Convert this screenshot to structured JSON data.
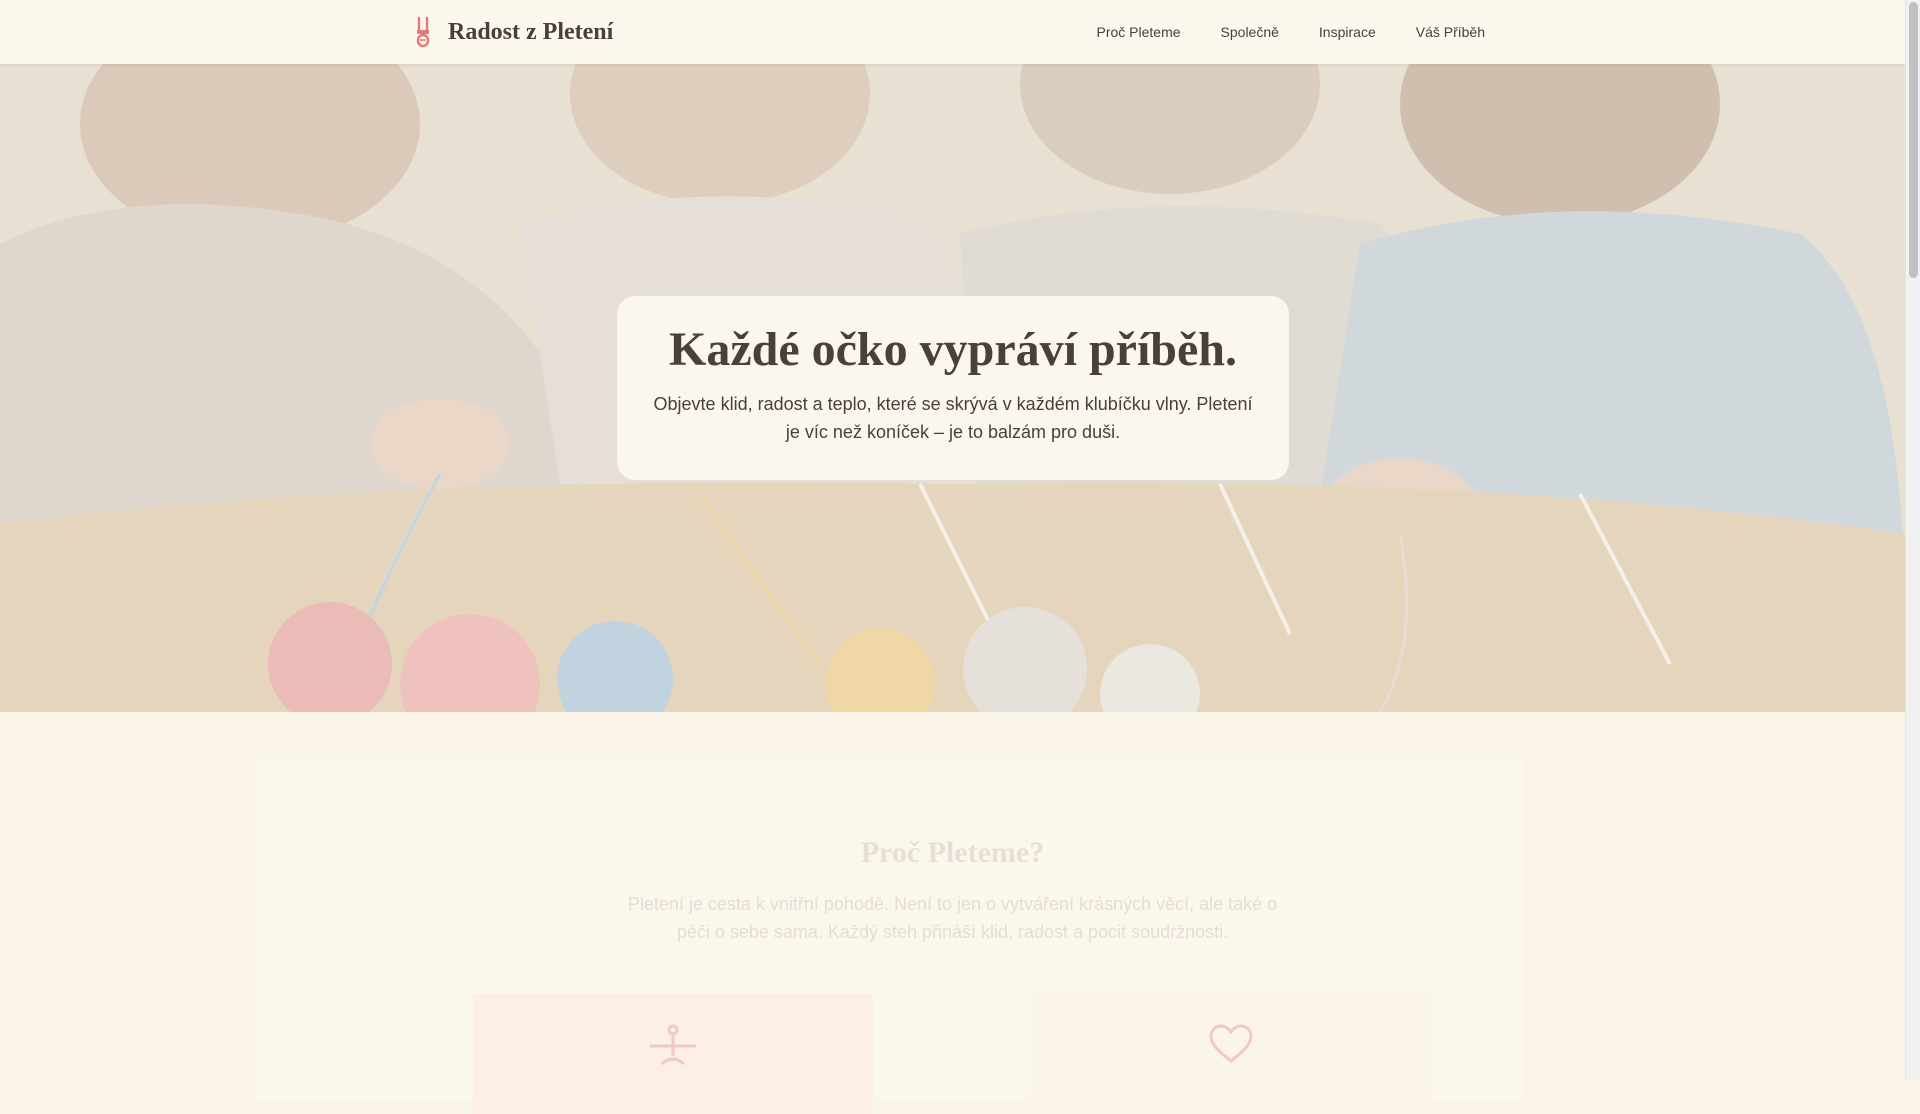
{
  "header": {
    "brand_title": "Radost z Pletení",
    "logo_icon": "yarn-needles-icon",
    "nav": [
      {
        "label": "Proč Pleteme"
      },
      {
        "label": "Společně"
      },
      {
        "label": "Inspirace"
      },
      {
        "label": "Váš Příběh"
      }
    ]
  },
  "hero": {
    "heading": "Každé očko vypráví příběh.",
    "subtitle": "Objevte klid, radost a teplo, které se skrývá v každém klubíčku vlny. Pletení je víc než koníček – je to balzám pro duši.",
    "image": "women-knitting-photo"
  },
  "why": {
    "title": "Proč Pleteme?",
    "text": "Pletení je cesta k vnitřní pohodě. Není to jen o vytváření krásných věcí, ale také o péči o sebe sama. Každý steh přináší klid, radost a pocit soudržnosti.",
    "features": [
      {
        "icon": "lotus-meditation-icon"
      },
      {
        "icon": "heart-icon"
      }
    ]
  },
  "colors": {
    "accent": "#e07a7a",
    "text": "#4a3f3a",
    "background": "#fbf5e9"
  }
}
